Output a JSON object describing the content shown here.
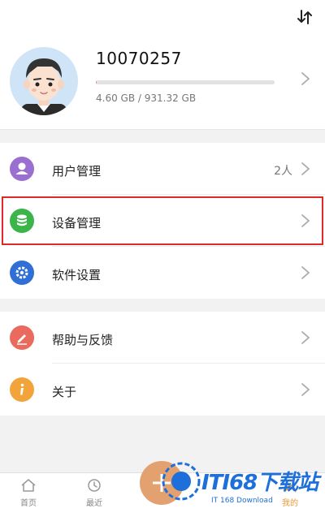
{
  "profile": {
    "user_id": "10070257",
    "storage_text": "4.60 GB / 931.32 GB",
    "storage_used_fraction": 0.005
  },
  "menu_group_1": [
    {
      "label": "用户管理",
      "count": "2人",
      "icon": "user-icon",
      "color": "#9b6fcf"
    },
    {
      "label": "设备管理",
      "icon": "database-icon",
      "color": "#3bb54a",
      "highlighted": true
    },
    {
      "label": "软件设置",
      "icon": "gear-icon",
      "color": "#2f6fd6"
    }
  ],
  "menu_group_2": [
    {
      "label": "帮助与反馈",
      "icon": "pencil-icon",
      "color": "#ea6a5e"
    },
    {
      "label": "关于",
      "icon": "info-icon",
      "color": "#f2a33a"
    }
  ],
  "tabbar": {
    "home": "首页",
    "recent": "最近",
    "mine": "我的"
  },
  "watermark": {
    "title": "ITI68下载站",
    "subtitle": "IT 168 Download"
  },
  "colors": {
    "accent": "#e99a3a",
    "highlight_border": "#e0282e"
  }
}
